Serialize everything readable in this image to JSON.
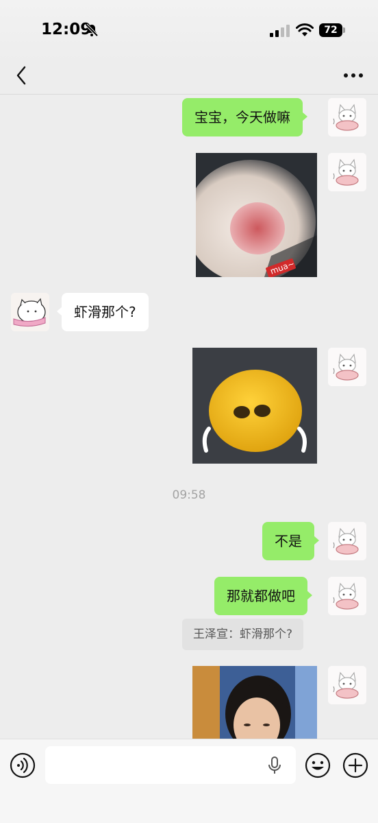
{
  "status_bar": {
    "time": "12:09",
    "battery_level": "72"
  },
  "nav": {
    "back_icon": "chevron-left-icon",
    "more_icon": "ellipsis-icon"
  },
  "messages": [
    {
      "type": "text",
      "from": "self",
      "text": "宝宝，今天做嘛"
    },
    {
      "type": "sticker",
      "from": "self",
      "description_label": "mua~"
    },
    {
      "type": "text",
      "from": "other",
      "text": "虾滑那个?"
    },
    {
      "type": "sticker",
      "from": "self"
    },
    {
      "type": "time",
      "text": "09:58"
    },
    {
      "type": "text",
      "from": "self",
      "text": "不是"
    },
    {
      "type": "text",
      "from": "self",
      "text": "那就都做吧"
    },
    {
      "type": "quote",
      "text": "王泽宣：虾滑那个?"
    },
    {
      "type": "sticker",
      "from": "self"
    }
  ],
  "input_bar": {
    "voice_icon": "voice-mode-icon",
    "mic_icon": "microphone-icon",
    "emoji_icon": "emoji-icon",
    "plus_icon": "plus-icon",
    "placeholder": ""
  },
  "colors": {
    "outgoing_bubble": "#95ec69",
    "incoming_bubble": "#ffffff",
    "background": "#ededed"
  }
}
